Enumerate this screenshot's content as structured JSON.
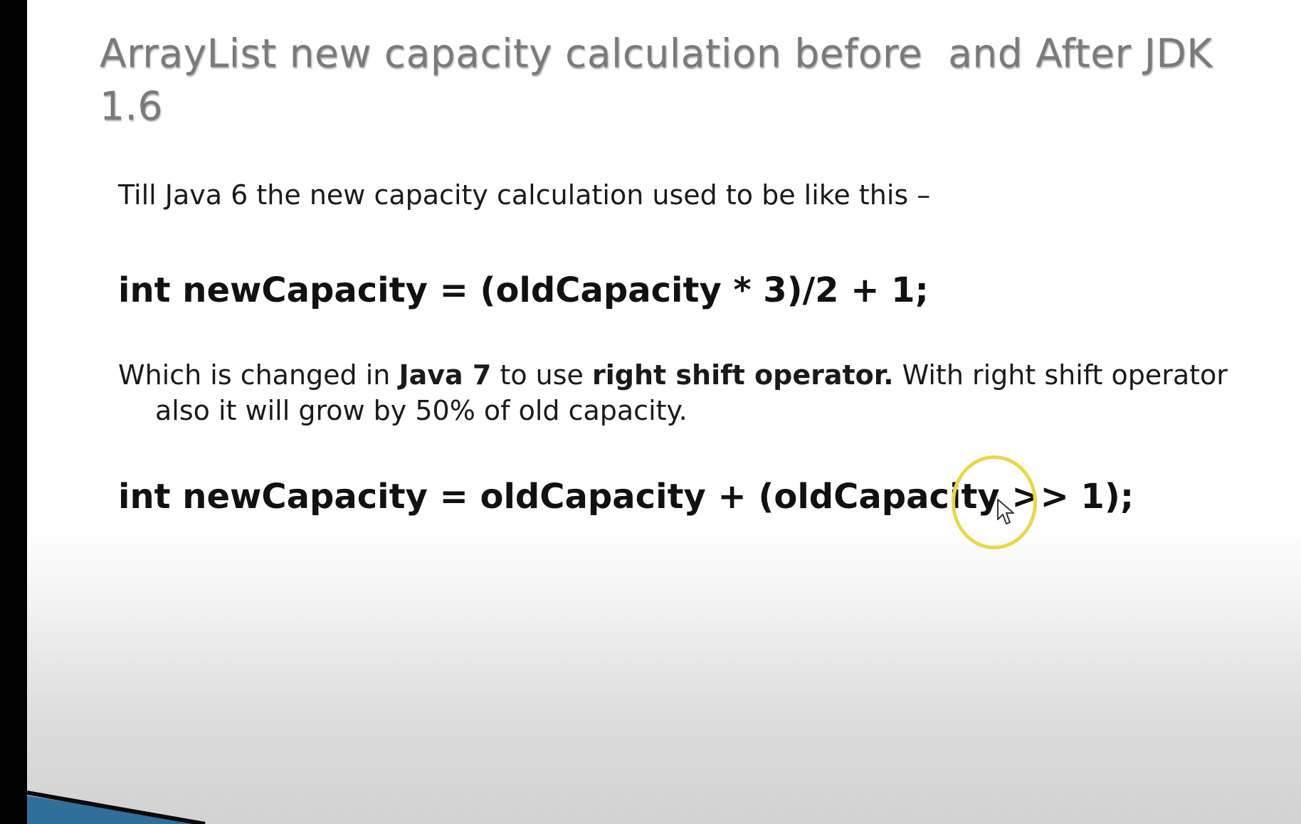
{
  "slide": {
    "title": "ArrayList new capacity calculation before  and After JDK 1.6",
    "intro": "Till Java 6 the new capacity calculation used to be like this –",
    "code_before": "int newCapacity = (oldCapacity * 3)/2 + 1;",
    "change": {
      "part1": "Which is changed in ",
      "bold1": "Java 7",
      "part2": " to use ",
      "bold2": "right shift operator.",
      "part3": " With right shift operator also it will grow by 50% of old capacity."
    },
    "code_after": "int newCapacity = oldCapacity + (oldCapacity >> 1);"
  },
  "colors": {
    "title": "#7a7a7a",
    "body": "#1a1a1a",
    "background_left": "#000000",
    "bottom_band": "#2f6f9a",
    "cursor_highlight": "#e8d84a"
  },
  "icons": {
    "cursor": "mouse-pointer-icon",
    "highlight": "cursor-highlight-ring"
  }
}
